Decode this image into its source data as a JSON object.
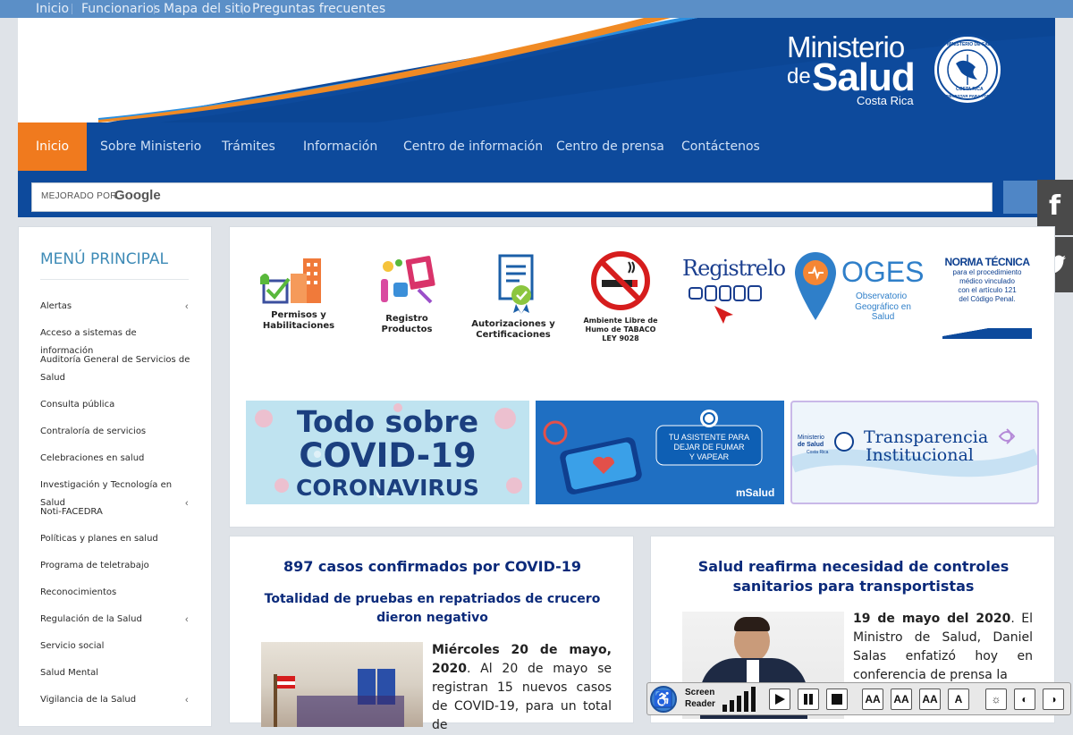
{
  "topnav": [
    "Inicio",
    "Funcionarios",
    "Mapa del sitio",
    "Preguntas frecuentes"
  ],
  "brand": {
    "line1": "Ministerio",
    "line2a": "de",
    "line2b": "Salud",
    "line3": "Costa Rica",
    "seal_top": "MINISTERIO DE SALUD",
    "seal_country": "COSTA RICA",
    "seal_bottom": "BIENESTAR PARA TODOS"
  },
  "mainnav": [
    "Inicio",
    "Sobre Ministerio",
    "Trámites",
    "Información",
    "Centro de información",
    "Centro de prensa",
    "Contáctenos"
  ],
  "search": {
    "label": "MEJORADO POR",
    "provider": "Google"
  },
  "social": [
    "f",
    "twitter"
  ],
  "sidebar": {
    "title": "MENÚ PRINCIPAL",
    "items": [
      "Alertas",
      "Acceso a sistemas de información",
      "Auditoría General de Servicios de Salud",
      "Consulta pública",
      "Contraloría de servicios",
      "Celebraciones en salud",
      "Investigación y Tecnología en Salud",
      "Noti-FACEDRA",
      "Políticas y planes en salud",
      "Programa de teletrabajo",
      "Reconocimientos",
      "Regulación de la Salud",
      "Servicio social",
      "Salud Mental",
      "Vigilancia de la Salud"
    ]
  },
  "quicklinks": {
    "permisos": [
      "Permisos y",
      "Habilitaciones"
    ],
    "registro": "Registro Productos",
    "autorizaciones": [
      "Autorizaciones y",
      "Certificaciones"
    ],
    "tabaco": [
      "Ambiente Libre de",
      "Humo de TABACO",
      "LEY 9028"
    ],
    "registrelo": "Registrelo",
    "oges": [
      "OGES",
      "Observatorio",
      "Geográfico en Salud"
    ],
    "norma": [
      "NORMA TÉCNICA",
      "para el procedimiento",
      "médico vinculado",
      "con el artículo 121",
      "del Código Penal."
    ]
  },
  "banners": {
    "covid": [
      "Todo sobre",
      "COVID-19",
      "CORONAVIRUS"
    ],
    "fumar": [
      "TU ASISTENTE PARA",
      "DEJAR DE FUMAR",
      "Y VAPEAR",
      "mSalud"
    ],
    "transparencia": [
      "Transparencia",
      "Institucional",
      "Ministerio",
      "de Salud",
      "Costa Rica"
    ]
  },
  "news1": {
    "title": "897 casos confirmados por COVID-19",
    "subtitle": "Totalidad de pruebas en repatriados de crucero dieron negativo",
    "date": "Miércoles 20 de mayo, 2020",
    "body": ". Al 20 de mayo se registran 15 nuevos casos de COVID-19, para un total de"
  },
  "news2": {
    "title": "Salud reafirma necesidad de controles sanitarios para transportistas",
    "date": "19 de mayo del 2020",
    "body": ". El Ministro de Salud, Daniel Salas enfatizó hoy en conferencia de prensa la"
  },
  "accessbar": {
    "line1": "Screen",
    "line2": "Reader"
  },
  "colors": {
    "navy": "#0d4a9c",
    "orange": "#f07a1e",
    "topbar": "#5b8fc7",
    "title": "#0b2a7a"
  }
}
